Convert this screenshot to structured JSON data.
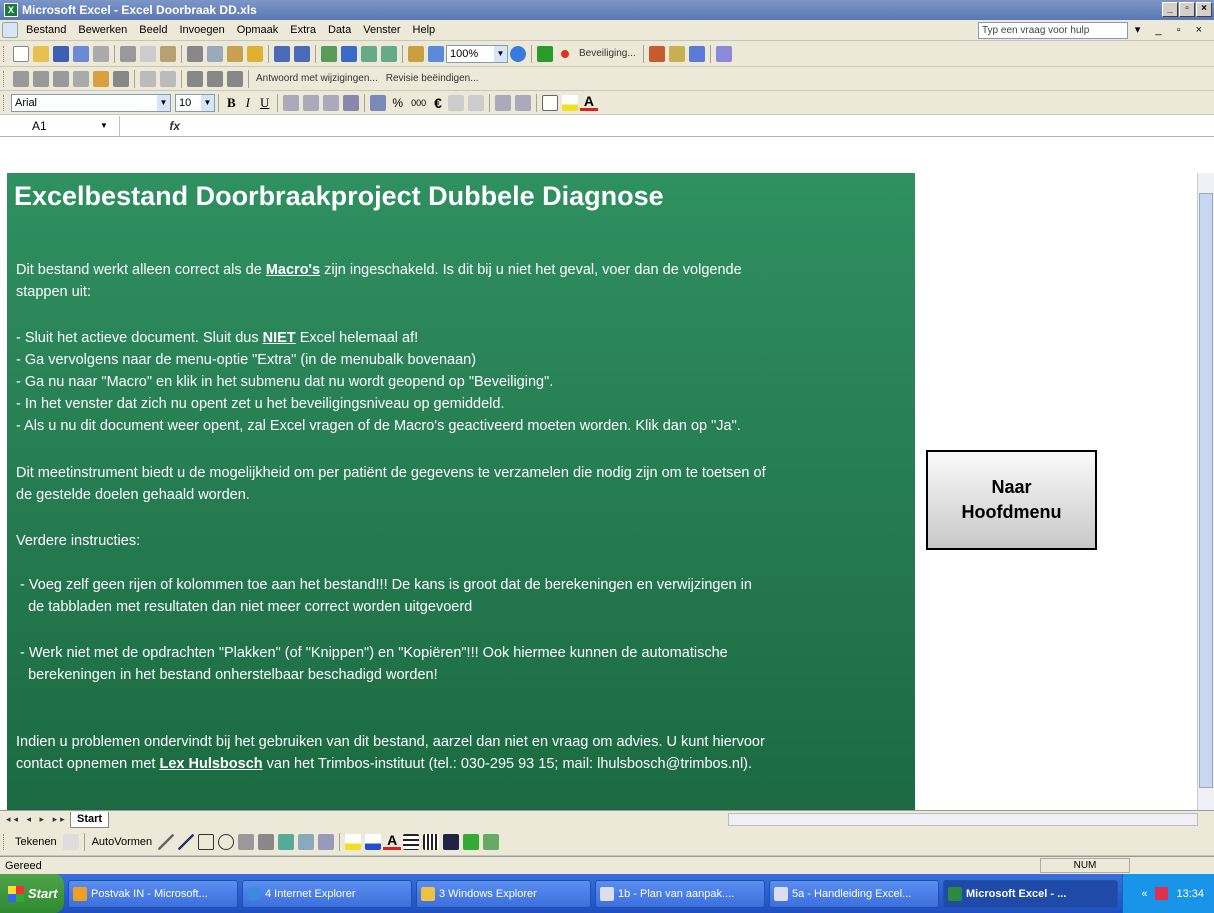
{
  "window": {
    "title": "Microsoft Excel - Excel Doorbraak DD.xls"
  },
  "menu": {
    "items": [
      "Bestand",
      "Bewerken",
      "Beeld",
      "Invoegen",
      "Opmaak",
      "Extra",
      "Data",
      "Venster",
      "Help"
    ],
    "help_placeholder": "Typ een vraag voor hulp"
  },
  "toolbar": {
    "zoom": "100%",
    "security": "Beveiliging...",
    "reply_changes": "Antwoord met wijzigingen...",
    "end_review": "Revisie beëindigen...",
    "font": "Arial",
    "font_size": "10"
  },
  "formula": {
    "cell_ref": "A1",
    "fx": "fx"
  },
  "sheet": {
    "heading": "Excelbestand Doorbraakproject Dubbele Diagnose",
    "p1a": "Dit bestand werkt alleen correct als de ",
    "p1link": "Macro's",
    "p1b": " zijn ingeschakeld. Is dit bij u niet het geval, voer dan de volgende",
    "p1c": "stappen uit:",
    "s1a": "- Sluit het actieve document. Sluit dus ",
    "s1b": "NIET",
    "s1c": " Excel helemaal af!",
    "s2": "- Ga vervolgens naar de menu-optie \"Extra\" (in de menubalk bovenaan)",
    "s3": "- Ga nu naar \"Macro\" en klik in het submenu dat nu wordt geopend op \"Beveiliging\".",
    "s4": "- In het venster dat zich nu opent zet u het beveiligingsniveau op gemiddeld.",
    "s5": "- Als u nu dit document weer opent, zal Excel vragen of de Macro's geactiveerd moeten worden. Klik dan op \"Ja\".",
    "p2a": "Dit meetinstrument biedt u de mogelijkheid om per patiënt de gegevens te verzamelen die nodig zijn om te toetsen of",
    "p2b": "de gestelde doelen gehaald worden.",
    "p3": "Verdere instructies:",
    "i1a": " - Voeg zelf geen rijen of kolommen toe aan het bestand!!! De kans is groot dat de berekeningen en verwijzingen in",
    "i1b": "   de tabbladen met resultaten dan niet meer correct worden uitgevoerd",
    "i2a": " - Werk niet met de opdrachten \"Plakken\" (of \"Knippen\") en \"Kopiëren\"!!! Ook hiermee kunnen de automatische",
    "i2b": "   berekeningen in het bestand onherstelbaar beschadigd worden!",
    "c1": "Indien u problemen ondervindt bij het gebruiken van dit bestand, aarzel dan niet en vraag om advies. U kunt hiervoor",
    "c2a": "contact opnemen met ",
    "c2link": "Lex Hulsbosch",
    "c2b": " van het Trimbos-instituut (tel.: 030-295 93 15; mail: lhulsbosch@trimbos.nl)."
  },
  "button": {
    "line1": "Naar",
    "line2": "Hoofdmenu"
  },
  "tabs": {
    "sheet": "Start"
  },
  "drawing": {
    "draw": "Tekenen",
    "autoshapes": "AutoVormen"
  },
  "status": {
    "left": "Gereed",
    "num": "NUM"
  },
  "taskbar": {
    "start": "Start",
    "items": [
      "Postvak IN - Microsoft...",
      "4 Internet Explorer",
      "3 Windows Explorer",
      "1b - Plan van aanpak....",
      "5a - Handleiding Excel...",
      "Microsoft Excel - ..."
    ],
    "clock": "13:34"
  }
}
